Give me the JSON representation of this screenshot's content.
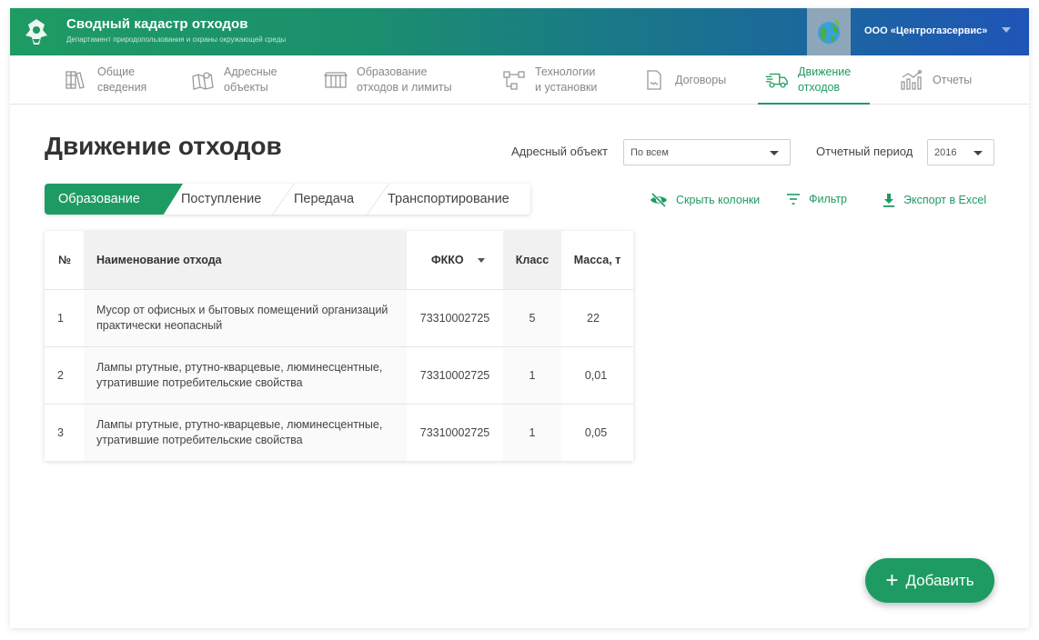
{
  "header": {
    "title": "Сводный кадастр отходов",
    "subtitle": "Департамент природопользования и охраны окружающей среды",
    "organization": "ООО «Центрогазсервис»",
    "colors": {
      "start": "#1e9b63",
      "end": "#1f55b8"
    }
  },
  "nav": {
    "items": [
      {
        "label": "Общие\nсведения",
        "icon": "books-icon"
      },
      {
        "label": "Адресные\nобъекты",
        "icon": "map-icon"
      },
      {
        "label": "Образование\nотходов и лимиты",
        "icon": "container-icon"
      },
      {
        "label": "Технологии\nи установки",
        "icon": "flow-icon"
      },
      {
        "label": "Договоры",
        "icon": "document-icon"
      },
      {
        "label": "Движение\nотходов",
        "icon": "truck-icon",
        "active": true
      },
      {
        "label": "Отчеты",
        "icon": "chart-icon"
      }
    ]
  },
  "page": {
    "title": "Движение отходов"
  },
  "filters": {
    "address_label": "Адресный объект",
    "address_value": "По всем",
    "period_label": "Отчетный период",
    "period_value": "2016"
  },
  "tabs": [
    {
      "label": "Образование",
      "active": true
    },
    {
      "label": "Поступление"
    },
    {
      "label": "Передача"
    },
    {
      "label": "Транспортирование"
    }
  ],
  "actions": {
    "hide_columns": "Скрыть колонки",
    "filter": "Фильтр",
    "export": "Экспорт в Excel"
  },
  "table": {
    "headers": {
      "num": "№",
      "name": "Наименование отхода",
      "fkko": "ФККО",
      "class": "Класс",
      "mass": "Масса, т"
    },
    "rows": [
      {
        "num": "1",
        "name": "Мусор от офисных и бытовых помещений организаций практически неопасный",
        "fkko": "73310002725",
        "class": "5",
        "mass": "22"
      },
      {
        "num": "2",
        "name": "Лампы ртутные, ртутно-кварцевые, люминесцентные, утратившие потребительские свойства",
        "fkko": "73310002725",
        "class": "1",
        "mass": "0,01"
      },
      {
        "num": "3",
        "name": "Лампы ртутные, ртутно-кварцевые, люминесцентные, утратившие потребительские свойства",
        "fkko": "73310002725",
        "class": "1",
        "mass": "0,05"
      }
    ]
  },
  "fab": {
    "label": "Добавить"
  },
  "accent_color": "#1e9b63"
}
